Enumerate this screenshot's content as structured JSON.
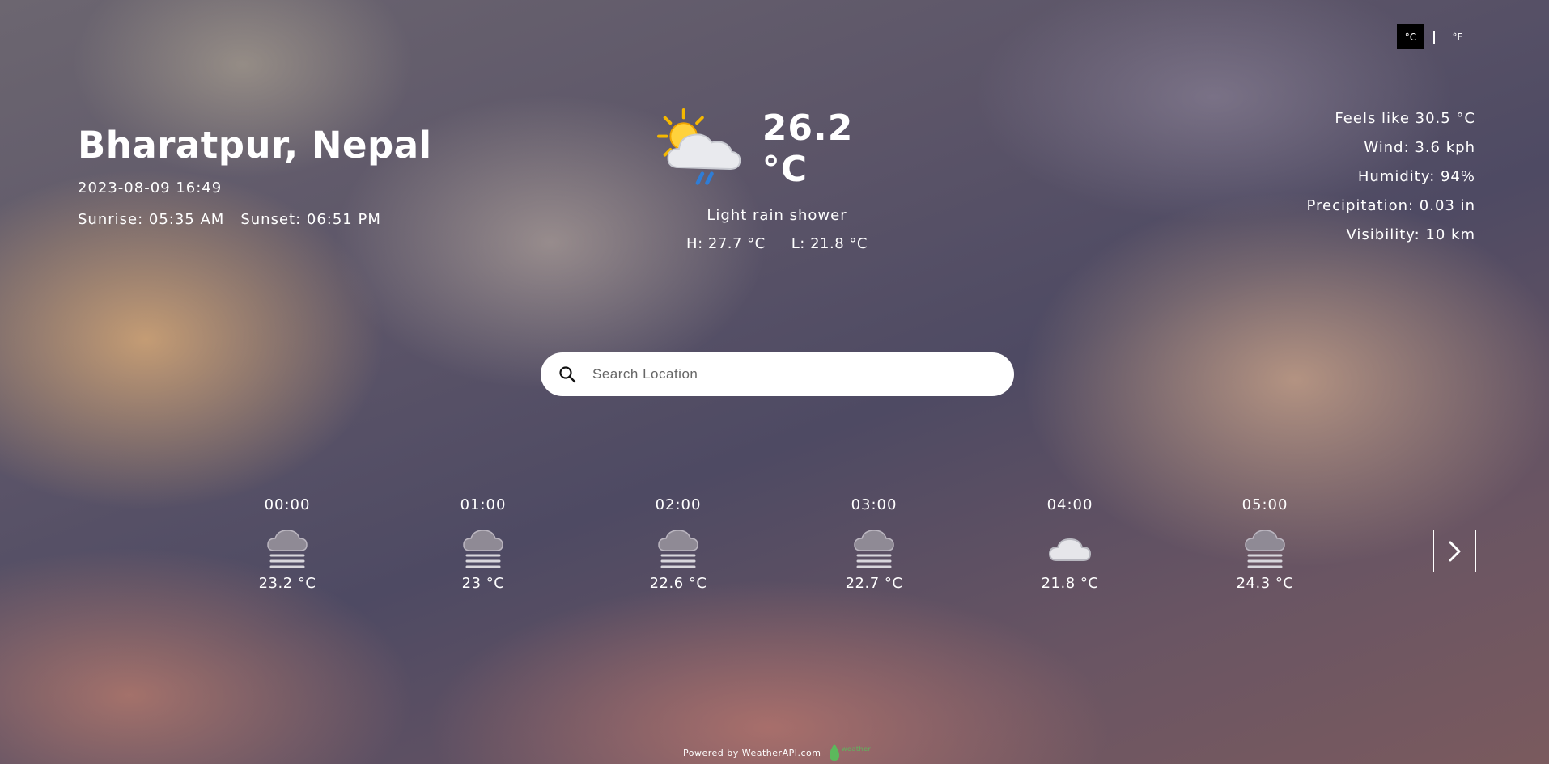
{
  "units": {
    "celsius": "°C",
    "fahrenheit": "°F",
    "active": "celsius"
  },
  "location": {
    "city": "Bharatpur, Nepal",
    "datetime": "2023-08-09 16:49",
    "sunrise": "Sunrise: 05:35 AM",
    "sunset": "Sunset: 06:51 PM"
  },
  "current": {
    "icon": "partly-cloudy-rain-icon",
    "temp": "26.2 °C",
    "condition": "Light rain shower",
    "high": "H: 27.7 °C",
    "low": "L: 21.8 °C"
  },
  "details": {
    "feels_like": "Feels like 30.5 °C",
    "wind": "Wind: 3.6 kph",
    "humidity": "Humidity: 94%",
    "precipitation": "Precipitation: 0.03 in",
    "visibility": "Visibility: 10 km"
  },
  "search": {
    "placeholder": "Search Location"
  },
  "hourly": [
    {
      "time": "00:00",
      "temp": "23.2 °C",
      "icon": "fog-icon"
    },
    {
      "time": "01:00",
      "temp": "23 °C",
      "icon": "fog-icon"
    },
    {
      "time": "02:00",
      "temp": "22.6 °C",
      "icon": "fog-icon"
    },
    {
      "time": "03:00",
      "temp": "22.7 °C",
      "icon": "fog-icon"
    },
    {
      "time": "04:00",
      "temp": "21.8 °C",
      "icon": "cloud-icon"
    },
    {
      "time": "05:00",
      "temp": "24.3 °C",
      "icon": "fog-icon"
    }
  ],
  "footer": {
    "powered_by": "Powered by WeatherAPI.com",
    "logo_text": "weather api"
  },
  "colors": {
    "accent_active": "#000000",
    "text": "#ffffff",
    "logo_green": "#5cb85c"
  }
}
